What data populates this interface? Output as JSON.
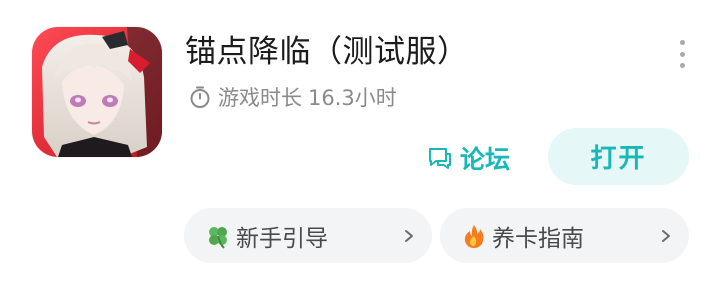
{
  "app": {
    "title": "锚点降临（测试服）",
    "icon_name": "app-icon-anime-character"
  },
  "playtime": {
    "icon": "timer-icon",
    "label": "游戏时长",
    "value": "16.3小时"
  },
  "actions": {
    "forum": {
      "icon": "chat-bubble-icon",
      "label": "论坛"
    },
    "open_label": "打开"
  },
  "chips": [
    {
      "icon": "clover-icon",
      "label": "新手引导"
    },
    {
      "icon": "fire-icon",
      "label": "养卡指南"
    }
  ],
  "colors": {
    "accent": "#18b8b6",
    "accent_bg": "#e6f7f7",
    "chip_bg": "#f2f4f5",
    "secondary_text": "#8a8a8a",
    "icon_red": "#e0202f"
  }
}
